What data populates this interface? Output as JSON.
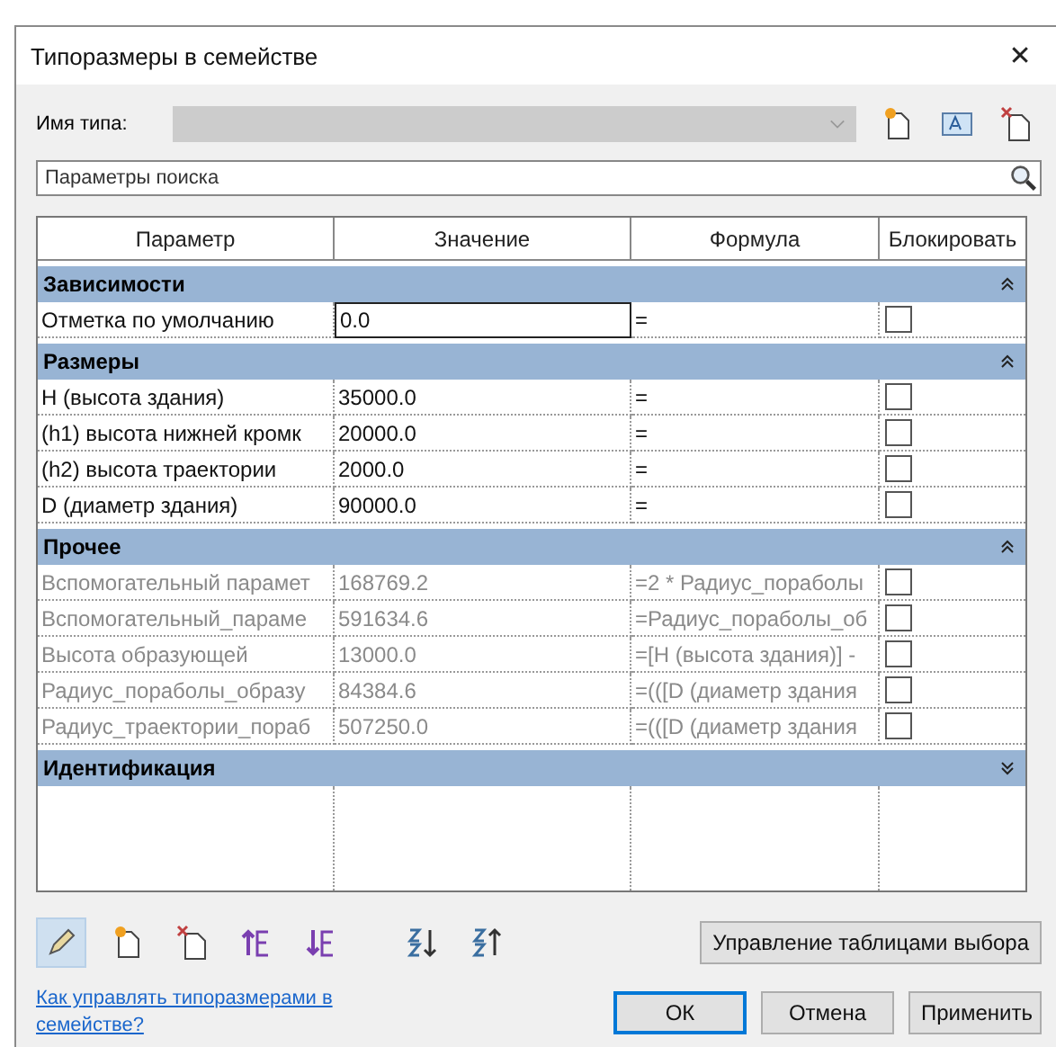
{
  "window": {
    "title": "Типоразмеры в семействе",
    "close": "✕"
  },
  "type_name": {
    "label": "Имя типа:",
    "disabled": true
  },
  "search": {
    "placeholder": "Параметры поиска"
  },
  "table": {
    "columns": [
      "Параметр",
      "Значение",
      "Формула",
      "Блокировать"
    ],
    "groups": [
      {
        "name": "Зависимости",
        "expanded": true,
        "rows": [
          {
            "name": "Отметка по умолчанию",
            "value": "0.0",
            "formula": "=",
            "locked": false,
            "disabled": false,
            "editing": true
          }
        ]
      },
      {
        "name": "Размеры",
        "expanded": true,
        "rows": [
          {
            "name": "H (высота здания)",
            "value": "35000.0",
            "formula": "=",
            "locked": false,
            "disabled": false,
            "editing": false
          },
          {
            "name": "(h1) высота нижней кромк",
            "value": "20000.0",
            "formula": "=",
            "locked": false,
            "disabled": false,
            "editing": false
          },
          {
            "name": "(h2) высота траектории",
            "value": "2000.0",
            "formula": "=",
            "locked": false,
            "disabled": false,
            "editing": false
          },
          {
            "name": "D (диаметр здания)",
            "value": "90000.0",
            "formula": "=",
            "locked": false,
            "disabled": false,
            "editing": false
          }
        ]
      },
      {
        "name": "Прочее",
        "expanded": true,
        "rows": [
          {
            "name": "Вспомогательный парамет",
            "value": "168769.2",
            "formula": "=2 * Радиус_пораболы",
            "locked": false,
            "disabled": true,
            "editing": false
          },
          {
            "name": "Вспомогательный_параме",
            "value": "591634.6",
            "formula": "=Радиус_пораболы_об",
            "locked": false,
            "disabled": true,
            "editing": false
          },
          {
            "name": "Высота образующей",
            "value": "13000.0",
            "formula": "=[H (высота здания)] -",
            "locked": false,
            "disabled": true,
            "editing": false
          },
          {
            "name": "Радиус_пораболы_образу",
            "value": "84384.6",
            "formula": "=(([D (диаметр здания",
            "locked": false,
            "disabled": true,
            "editing": false
          },
          {
            "name": "Радиус_траектории_пораб",
            "value": "507250.0",
            "formula": "=(([D (диаметр здания",
            "locked": false,
            "disabled": true,
            "editing": false
          }
        ]
      },
      {
        "name": "Идентификация",
        "expanded": false
      }
    ]
  },
  "lookup_button": "Управление таблицами выбора",
  "help_link": "Как управлять типоразмерами в семействе?",
  "buttons": [
    {
      "label": "ОК",
      "default": true
    },
    {
      "label": "Отмена",
      "default": false
    },
    {
      "label": "Применить",
      "default": false
    }
  ]
}
